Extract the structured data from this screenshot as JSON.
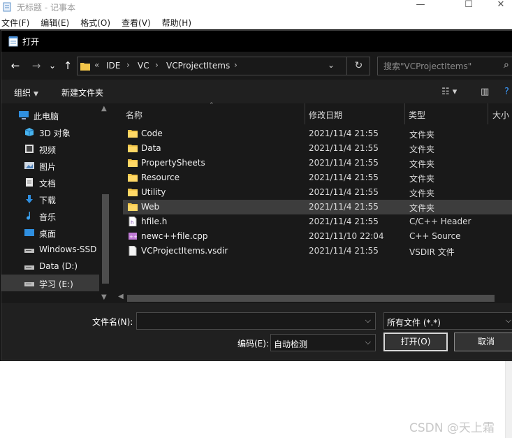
{
  "notepad": {
    "title": "无标题 - 记事本",
    "menu": [
      "文件(F)",
      "编辑(E)",
      "格式(O)",
      "查看(V)",
      "帮助(H)"
    ],
    "controls": {
      "minimize": "—",
      "maximize": "☐",
      "close": "✕"
    }
  },
  "dialog": {
    "title": "打开",
    "nav": {
      "back": "←",
      "forward": "→",
      "recent": "⌄",
      "up": "↑"
    },
    "breadcrumb": [
      "IDE",
      "VC",
      "VCProjectItems"
    ],
    "breadcrumb_more": "«",
    "search_placeholder": "搜索\"VCProjectItems\"",
    "toolbar": {
      "organize": "组织",
      "new_folder": "新建文件夹"
    },
    "sidebar": [
      {
        "label": "此电脑",
        "icon": "computer-icon"
      },
      {
        "label": "3D 对象",
        "icon": "3d-objects-icon"
      },
      {
        "label": "视频",
        "icon": "video-icon"
      },
      {
        "label": "图片",
        "icon": "pictures-icon"
      },
      {
        "label": "文档",
        "icon": "documents-icon"
      },
      {
        "label": "下载",
        "icon": "download-icon"
      },
      {
        "label": "音乐",
        "icon": "music-icon"
      },
      {
        "label": "桌面",
        "icon": "desktop-icon"
      },
      {
        "label": "Windows-SSD",
        "icon": "drive-icon"
      },
      {
        "label": "Data (D:)",
        "icon": "drive-icon"
      },
      {
        "label": "学习 (E:)",
        "icon": "drive-icon"
      }
    ],
    "columns": {
      "name": "名称",
      "modified": "修改日期",
      "type": "类型",
      "size": "大小"
    },
    "files": [
      {
        "name": "Code",
        "modified": "2021/11/4 21:55",
        "type": "文件夹",
        "icon": "folder-icon"
      },
      {
        "name": "Data",
        "modified": "2021/11/4 21:55",
        "type": "文件夹",
        "icon": "folder-icon"
      },
      {
        "name": "PropertySheets",
        "modified": "2021/11/4 21:55",
        "type": "文件夹",
        "icon": "folder-icon"
      },
      {
        "name": "Resource",
        "modified": "2021/11/4 21:55",
        "type": "文件夹",
        "icon": "folder-icon"
      },
      {
        "name": "Utility",
        "modified": "2021/11/4 21:55",
        "type": "文件夹",
        "icon": "folder-icon"
      },
      {
        "name": "Web",
        "modified": "2021/11/4 21:55",
        "type": "文件夹",
        "icon": "folder-icon"
      },
      {
        "name": "hfile.h",
        "modified": "2021/11/4 21:55",
        "type": "C/C++ Header",
        "icon": "header-file-icon"
      },
      {
        "name": "newc++file.cpp",
        "modified": "2021/11/10 22:04",
        "type": "C++ Source",
        "icon": "cpp-file-icon"
      },
      {
        "name": "VCProjectItems.vsdir",
        "modified": "2021/11/4 21:55",
        "type": "VSDIR 文件",
        "icon": "file-icon"
      }
    ],
    "selected_file_index": 5,
    "selected_sidebar_index": 10,
    "footer": {
      "filename_label": "文件名(N):",
      "filename_value": "",
      "filetype_value": "所有文件  (*.*)",
      "encoding_label": "编码(E):",
      "encoding_value": "自动检测",
      "open_button": "打开(O)",
      "cancel_button": "取消"
    }
  },
  "watermark": "CSDN @天上霜"
}
